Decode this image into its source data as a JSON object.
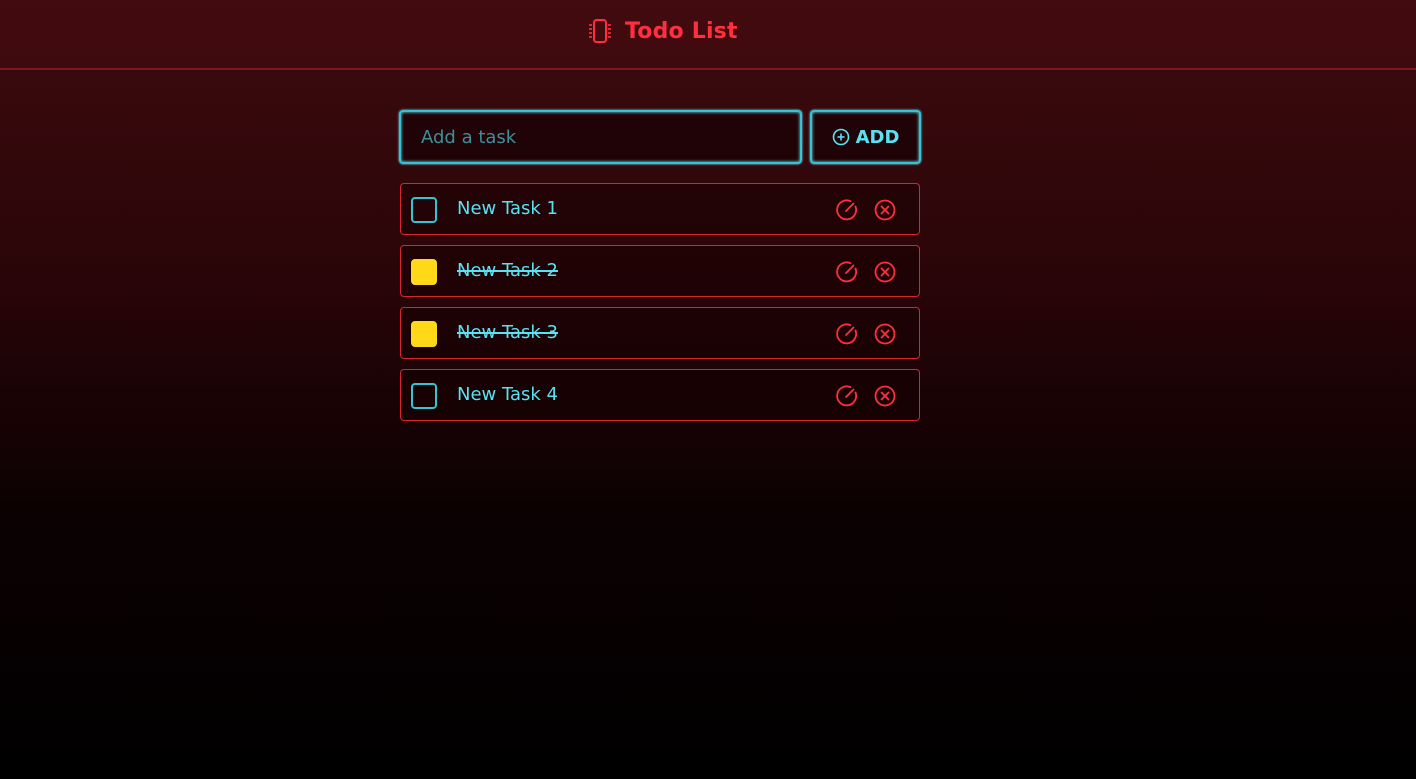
{
  "header": {
    "title": "Todo List",
    "icon": "chip-icon"
  },
  "add_form": {
    "input_placeholder": "Add a task",
    "input_value": "",
    "button_label": "ADD",
    "button_icon": "plus-circle-icon"
  },
  "tasks": [
    {
      "label": "New Task 1",
      "completed": false
    },
    {
      "label": "New Task 2",
      "completed": true
    },
    {
      "label": "New Task 3",
      "completed": true
    },
    {
      "label": "New Task 4",
      "completed": false
    }
  ],
  "task_actions": {
    "edit_icon": "edit-icon",
    "delete_icon": "delete-icon"
  },
  "colors": {
    "accent_red": "#ff2f3d",
    "border_red": "#d8252d",
    "cyan": "#59e2f2",
    "cyan_border": "#35c3d6",
    "checked_yellow": "#ffd817",
    "background_top": "#3e0b0f",
    "background_bottom": "#000000"
  }
}
